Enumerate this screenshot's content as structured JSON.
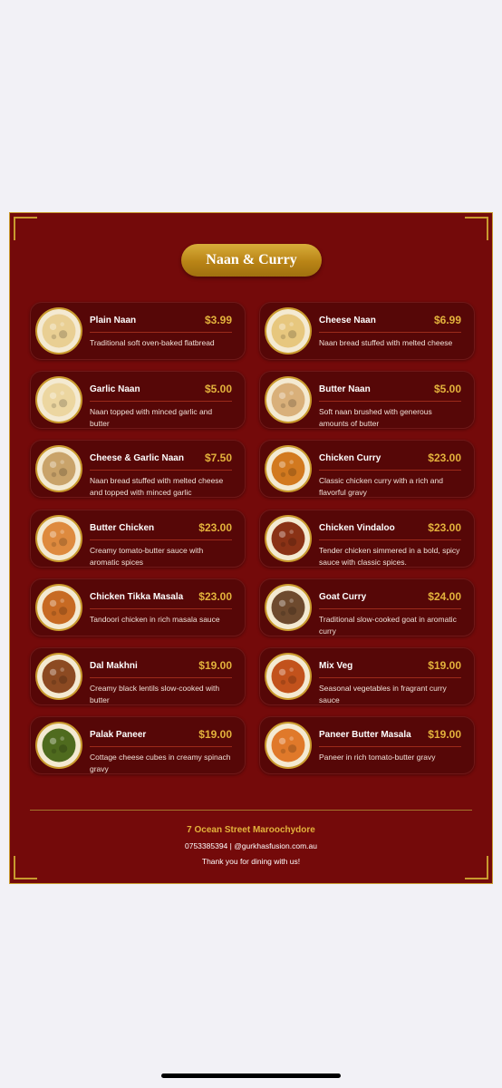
{
  "menu": {
    "title": "Naan & Curry",
    "items": [
      {
        "name": "Plain Naan",
        "price": "$3.99",
        "description": "Traditional soft oven-baked flatbread",
        "image_icon": "plain-naan-photo",
        "dish_color": "#e9cf93"
      },
      {
        "name": "Cheese Naan",
        "price": "$6.99",
        "description": "Naan bread stuffed with melted cheese",
        "image_icon": "cheese-naan-photo",
        "dish_color": "#e7c77e"
      },
      {
        "name": "Garlic Naan",
        "price": "$5.00",
        "description": "Naan topped with minced garlic and butter",
        "image_icon": "garlic-naan-photo",
        "dish_color": "#ecd6a0"
      },
      {
        "name": "Butter Naan",
        "price": "$5.00",
        "description": "Soft naan brushed with generous amounts of butter",
        "image_icon": "butter-naan-photo",
        "dish_color": "#d9b07a"
      },
      {
        "name": "Cheese & Garlic Naan",
        "price": "$7.50",
        "description": "Naan bread stuffed with melted cheese and topped with minced garlic",
        "image_icon": "cheese-garlic-naan-photo",
        "dish_color": "#c9a36a"
      },
      {
        "name": "Chicken Curry",
        "price": "$23.00",
        "description": "Classic chicken curry with a rich and flavorful gravy",
        "image_icon": "chicken-curry-photo",
        "dish_color": "#d2791f"
      },
      {
        "name": "Butter Chicken",
        "price": "$23.00",
        "description": "Creamy tomato-butter sauce with aromatic spices",
        "image_icon": "butter-chicken-photo",
        "dish_color": "#de8a3e"
      },
      {
        "name": "Chicken Vindaloo",
        "price": "$23.00",
        "description": "Tender chicken simmered in a bold, spicy sauce with classic spices.",
        "image_icon": "chicken-vindaloo-photo",
        "dish_color": "#8a3216"
      },
      {
        "name": "Chicken Tikka Masala",
        "price": "$23.00",
        "description": "Tandoori chicken in rich masala sauce",
        "image_icon": "chicken-tikka-masala-photo",
        "dish_color": "#c76a23"
      },
      {
        "name": "Goat Curry",
        "price": "$24.00",
        "description": "Traditional slow-cooked goat in aromatic curry",
        "image_icon": "goat-curry-photo",
        "dish_color": "#6e4a2e"
      },
      {
        "name": "Dal Makhni",
        "price": "$19.00",
        "description": "Creamy black lentils slow-cooked with butter",
        "image_icon": "dal-makhni-photo",
        "dish_color": "#8c4a22"
      },
      {
        "name": "Mix Veg",
        "price": "$19.00",
        "description": "Seasonal vegetables in fragrant curry sauce",
        "image_icon": "mix-veg-photo",
        "dish_color": "#c2521c"
      },
      {
        "name": "Palak Paneer",
        "price": "$19.00",
        "description": "Cottage cheese cubes in creamy spinach gravy",
        "image_icon": "palak-paneer-photo",
        "dish_color": "#4f6b1e"
      },
      {
        "name": "Paneer Butter Masala",
        "price": "$19.00",
        "description": "Paneer in rich tomato-butter gravy",
        "image_icon": "paneer-butter-masala-photo",
        "dish_color": "#e0792a"
      }
    ],
    "footer": {
      "address": "7 Ocean Street Maroochydore",
      "contact": "0753385394 | @gurkhasfusion.com.au",
      "thanks": "Thank you for dining with us!"
    }
  },
  "colors": {
    "card_background": "#740a0a",
    "item_background": "#560707",
    "accent_gold": "#e3b23c",
    "page_background": "#f2f1f6"
  }
}
